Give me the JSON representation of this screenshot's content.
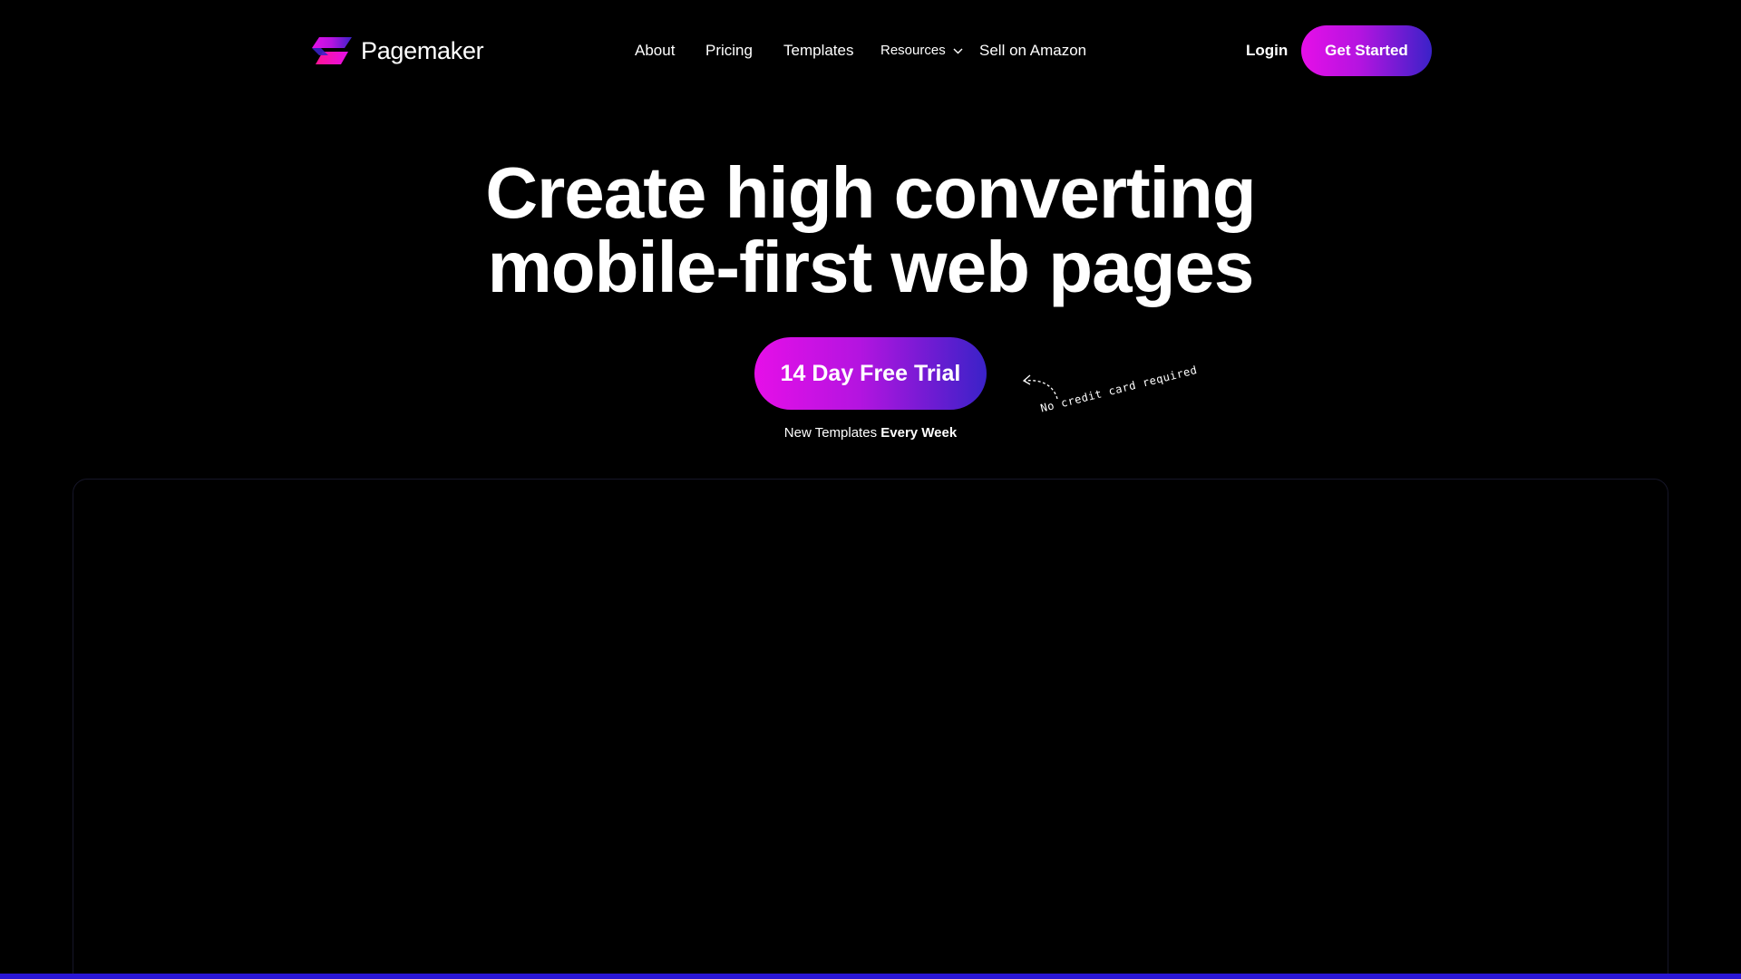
{
  "brand": {
    "name": "Pagemaker",
    "logo_icon": "pagemaker-logo-icon",
    "gradient_start": "#e60fe8",
    "gradient_mid": "#b414e0",
    "gradient_end": "#3a22c8"
  },
  "nav": {
    "links": [
      {
        "label": "About"
      },
      {
        "label": "Pricing"
      },
      {
        "label": "Templates"
      },
      {
        "label": "Resources",
        "icon": "chevron-down-icon"
      },
      {
        "label": "Sell on Amazon"
      }
    ],
    "login_label": "Login",
    "cta_label": "Get Started"
  },
  "hero": {
    "headline_line1": "Create high converting",
    "headline_line2": "mobile-first web pages",
    "trial_button": "14 Day Free Trial",
    "note_prefix": "New Templates",
    "note_strong": "Every Week",
    "handwritten_note": "No credit card required"
  },
  "colors": {
    "background": "#000000",
    "accent_bar": "#2a16d6",
    "frame_border": "#161628"
  }
}
